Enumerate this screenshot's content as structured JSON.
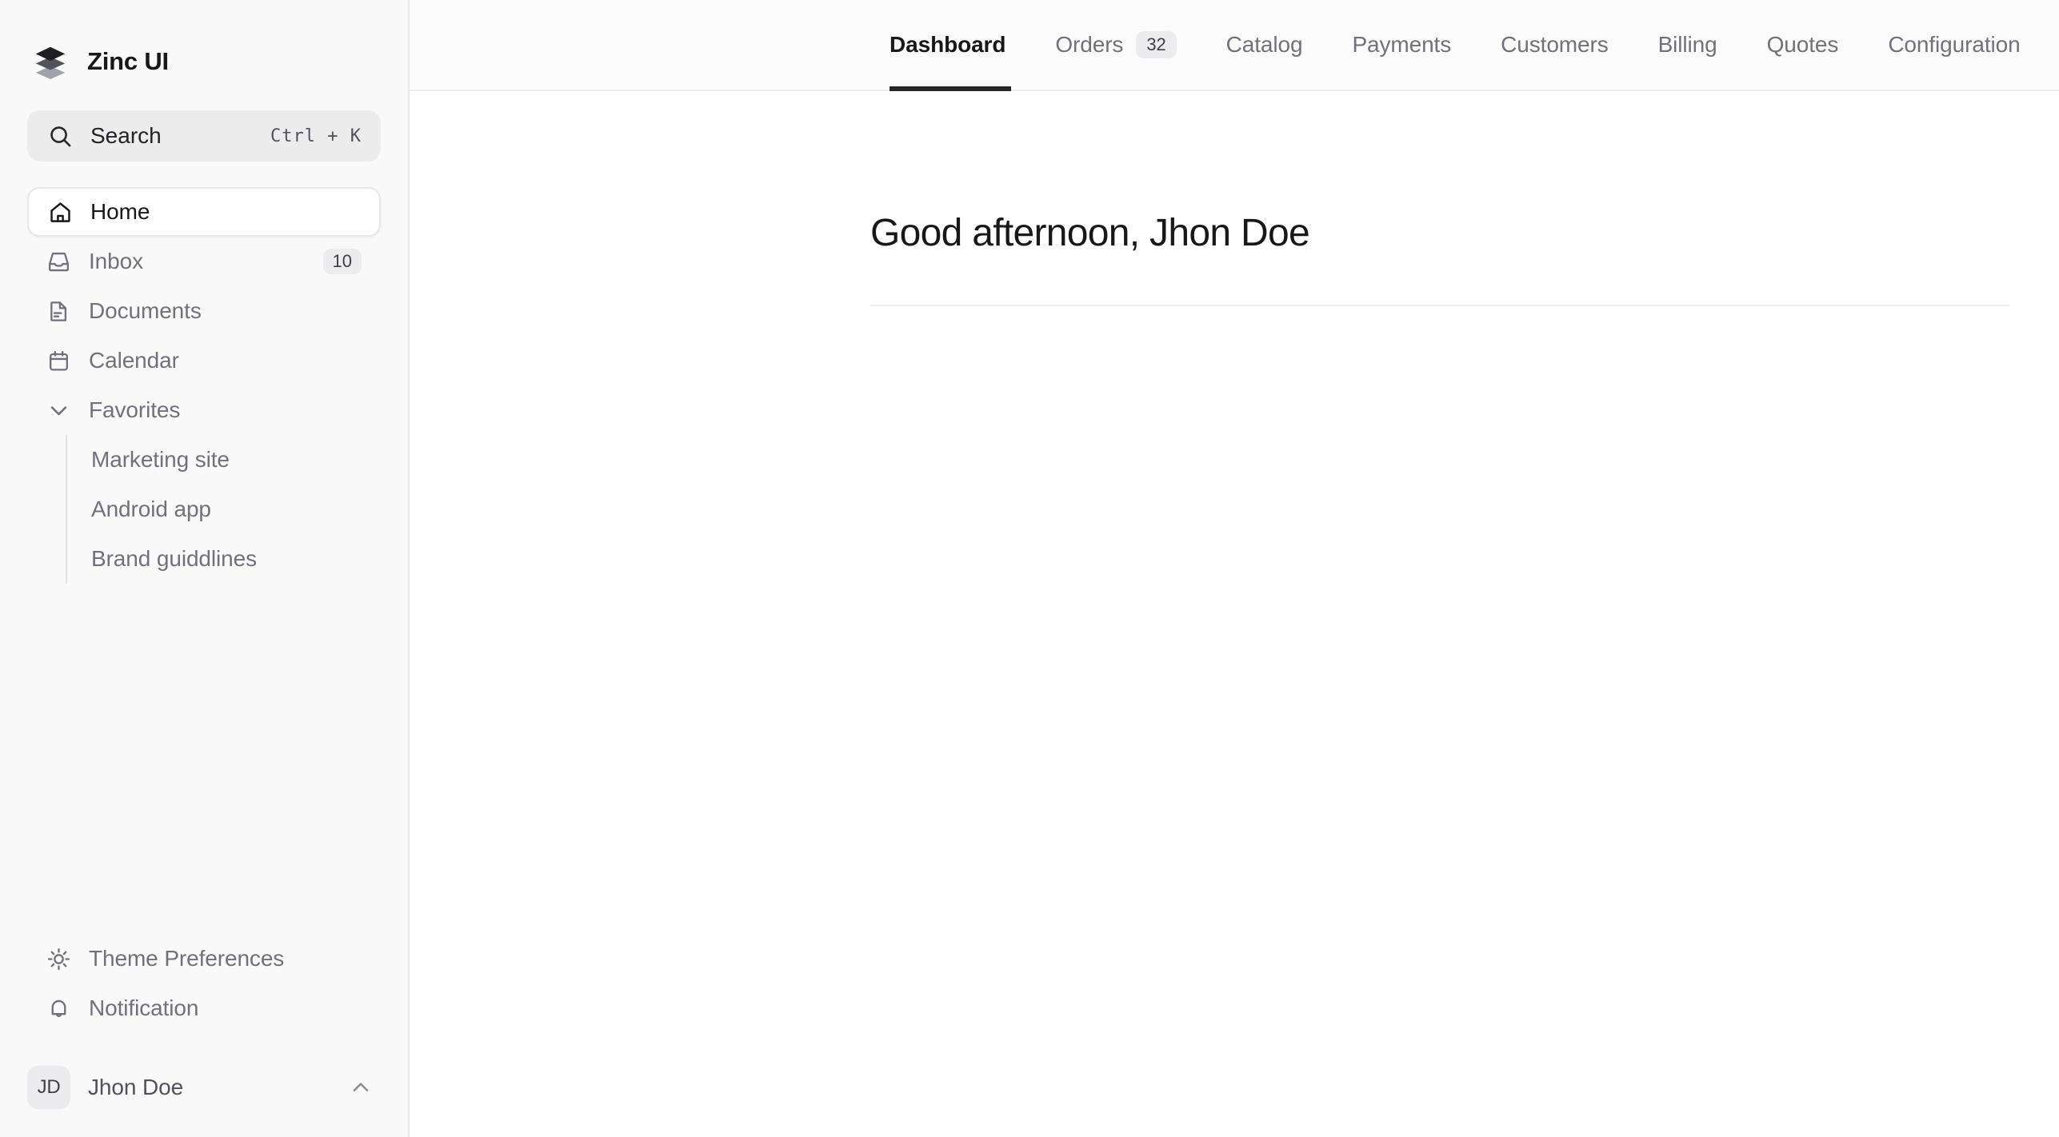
{
  "sidebar": {
    "brand": {
      "name": "Zinc UI",
      "logo_icon": "layers-stack-icon"
    },
    "search": {
      "label": "Search",
      "shortcut": "Ctrl + K",
      "icon": "search-icon"
    },
    "nav_items": [
      {
        "label": "Home",
        "icon": "home-icon",
        "active": true,
        "badge": ""
      },
      {
        "label": "Inbox",
        "icon": "inbox-icon",
        "active": false,
        "badge": "10"
      },
      {
        "label": "Documents",
        "icon": "document-icon",
        "active": false,
        "badge": ""
      },
      {
        "label": "Calendar",
        "icon": "calendar-icon",
        "active": false,
        "badge": ""
      }
    ],
    "favorites": {
      "label": "Favorites",
      "icon": "chevron-down-icon",
      "expanded": true,
      "items": [
        {
          "label": "Marketing site"
        },
        {
          "label": "Android app"
        },
        {
          "label": "Brand guiddlines"
        }
      ]
    },
    "bottom_items": [
      {
        "label": "Theme Preferences",
        "icon": "sun-icon"
      },
      {
        "label": "Notification",
        "icon": "bell-icon"
      }
    ],
    "user": {
      "initials": "JD",
      "name": "Jhon Doe",
      "caret_icon": "chevron-up-icon"
    }
  },
  "header": {
    "tabs": [
      {
        "label": "Dashboard",
        "badge": "",
        "active": true
      },
      {
        "label": "Orders",
        "badge": "32",
        "active": false
      },
      {
        "label": "Catalog",
        "badge": "",
        "active": false
      },
      {
        "label": "Payments",
        "badge": "",
        "active": false
      },
      {
        "label": "Customers",
        "badge": "",
        "active": false
      },
      {
        "label": "Billing",
        "badge": "",
        "active": false
      },
      {
        "label": "Quotes",
        "badge": "",
        "active": false
      },
      {
        "label": "Configuration",
        "badge": "",
        "active": false
      }
    ]
  },
  "main": {
    "greeting": "Good afternoon, Jhon Doe"
  },
  "colors": {
    "sidebar_bg": "#f9f9fa",
    "content_bg": "#ffffff",
    "border": "#ececee",
    "text_primary": "#18181b",
    "text_muted": "#71717a",
    "active_underline": "#27272a",
    "badge_bg": "#ececee"
  }
}
